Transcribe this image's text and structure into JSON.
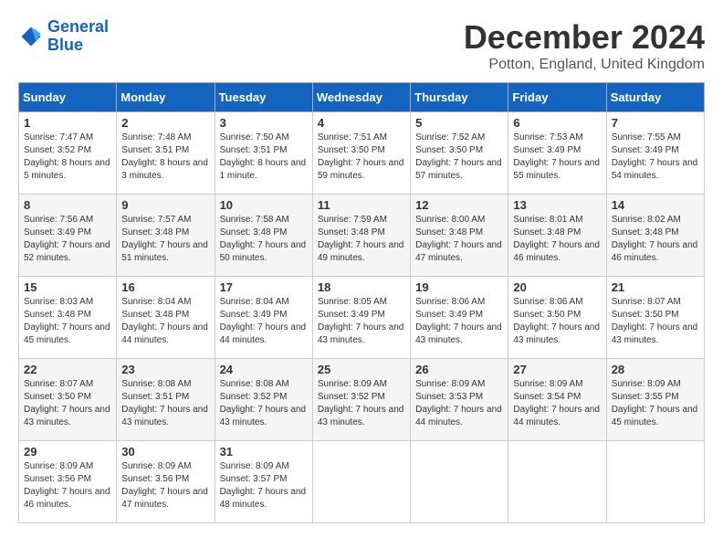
{
  "header": {
    "logo_line1": "General",
    "logo_line2": "Blue",
    "month_title": "December 2024",
    "location": "Potton, England, United Kingdom"
  },
  "weekdays": [
    "Sunday",
    "Monday",
    "Tuesday",
    "Wednesday",
    "Thursday",
    "Friday",
    "Saturday"
  ],
  "weeks": [
    [
      {
        "day": "1",
        "sunrise": "7:47 AM",
        "sunset": "3:52 PM",
        "daylight": "8 hours and 5 minutes."
      },
      {
        "day": "2",
        "sunrise": "7:48 AM",
        "sunset": "3:51 PM",
        "daylight": "8 hours and 3 minutes."
      },
      {
        "day": "3",
        "sunrise": "7:50 AM",
        "sunset": "3:51 PM",
        "daylight": "8 hours and 1 minute."
      },
      {
        "day": "4",
        "sunrise": "7:51 AM",
        "sunset": "3:50 PM",
        "daylight": "7 hours and 59 minutes."
      },
      {
        "day": "5",
        "sunrise": "7:52 AM",
        "sunset": "3:50 PM",
        "daylight": "7 hours and 57 minutes."
      },
      {
        "day": "6",
        "sunrise": "7:53 AM",
        "sunset": "3:49 PM",
        "daylight": "7 hours and 55 minutes."
      },
      {
        "day": "7",
        "sunrise": "7:55 AM",
        "sunset": "3:49 PM",
        "daylight": "7 hours and 54 minutes."
      }
    ],
    [
      {
        "day": "8",
        "sunrise": "7:56 AM",
        "sunset": "3:49 PM",
        "daylight": "7 hours and 52 minutes."
      },
      {
        "day": "9",
        "sunrise": "7:57 AM",
        "sunset": "3:48 PM",
        "daylight": "7 hours and 51 minutes."
      },
      {
        "day": "10",
        "sunrise": "7:58 AM",
        "sunset": "3:48 PM",
        "daylight": "7 hours and 50 minutes."
      },
      {
        "day": "11",
        "sunrise": "7:59 AM",
        "sunset": "3:48 PM",
        "daylight": "7 hours and 49 minutes."
      },
      {
        "day": "12",
        "sunrise": "8:00 AM",
        "sunset": "3:48 PM",
        "daylight": "7 hours and 47 minutes."
      },
      {
        "day": "13",
        "sunrise": "8:01 AM",
        "sunset": "3:48 PM",
        "daylight": "7 hours and 46 minutes."
      },
      {
        "day": "14",
        "sunrise": "8:02 AM",
        "sunset": "3:48 PM",
        "daylight": "7 hours and 46 minutes."
      }
    ],
    [
      {
        "day": "15",
        "sunrise": "8:03 AM",
        "sunset": "3:48 PM",
        "daylight": "7 hours and 45 minutes."
      },
      {
        "day": "16",
        "sunrise": "8:04 AM",
        "sunset": "3:48 PM",
        "daylight": "7 hours and 44 minutes."
      },
      {
        "day": "17",
        "sunrise": "8:04 AM",
        "sunset": "3:49 PM",
        "daylight": "7 hours and 44 minutes."
      },
      {
        "day": "18",
        "sunrise": "8:05 AM",
        "sunset": "3:49 PM",
        "daylight": "7 hours and 43 minutes."
      },
      {
        "day": "19",
        "sunrise": "8:06 AM",
        "sunset": "3:49 PM",
        "daylight": "7 hours and 43 minutes."
      },
      {
        "day": "20",
        "sunrise": "8:06 AM",
        "sunset": "3:50 PM",
        "daylight": "7 hours and 43 minutes."
      },
      {
        "day": "21",
        "sunrise": "8:07 AM",
        "sunset": "3:50 PM",
        "daylight": "7 hours and 43 minutes."
      }
    ],
    [
      {
        "day": "22",
        "sunrise": "8:07 AM",
        "sunset": "3:50 PM",
        "daylight": "7 hours and 43 minutes."
      },
      {
        "day": "23",
        "sunrise": "8:08 AM",
        "sunset": "3:51 PM",
        "daylight": "7 hours and 43 minutes."
      },
      {
        "day": "24",
        "sunrise": "8:08 AM",
        "sunset": "3:52 PM",
        "daylight": "7 hours and 43 minutes."
      },
      {
        "day": "25",
        "sunrise": "8:09 AM",
        "sunset": "3:52 PM",
        "daylight": "7 hours and 43 minutes."
      },
      {
        "day": "26",
        "sunrise": "8:09 AM",
        "sunset": "3:53 PM",
        "daylight": "7 hours and 44 minutes."
      },
      {
        "day": "27",
        "sunrise": "8:09 AM",
        "sunset": "3:54 PM",
        "daylight": "7 hours and 44 minutes."
      },
      {
        "day": "28",
        "sunrise": "8:09 AM",
        "sunset": "3:55 PM",
        "daylight": "7 hours and 45 minutes."
      }
    ],
    [
      {
        "day": "29",
        "sunrise": "8:09 AM",
        "sunset": "3:56 PM",
        "daylight": "7 hours and 46 minutes."
      },
      {
        "day": "30",
        "sunrise": "8:09 AM",
        "sunset": "3:56 PM",
        "daylight": "7 hours and 47 minutes."
      },
      {
        "day": "31",
        "sunrise": "8:09 AM",
        "sunset": "3:57 PM",
        "daylight": "7 hours and 48 minutes."
      },
      null,
      null,
      null,
      null
    ]
  ]
}
